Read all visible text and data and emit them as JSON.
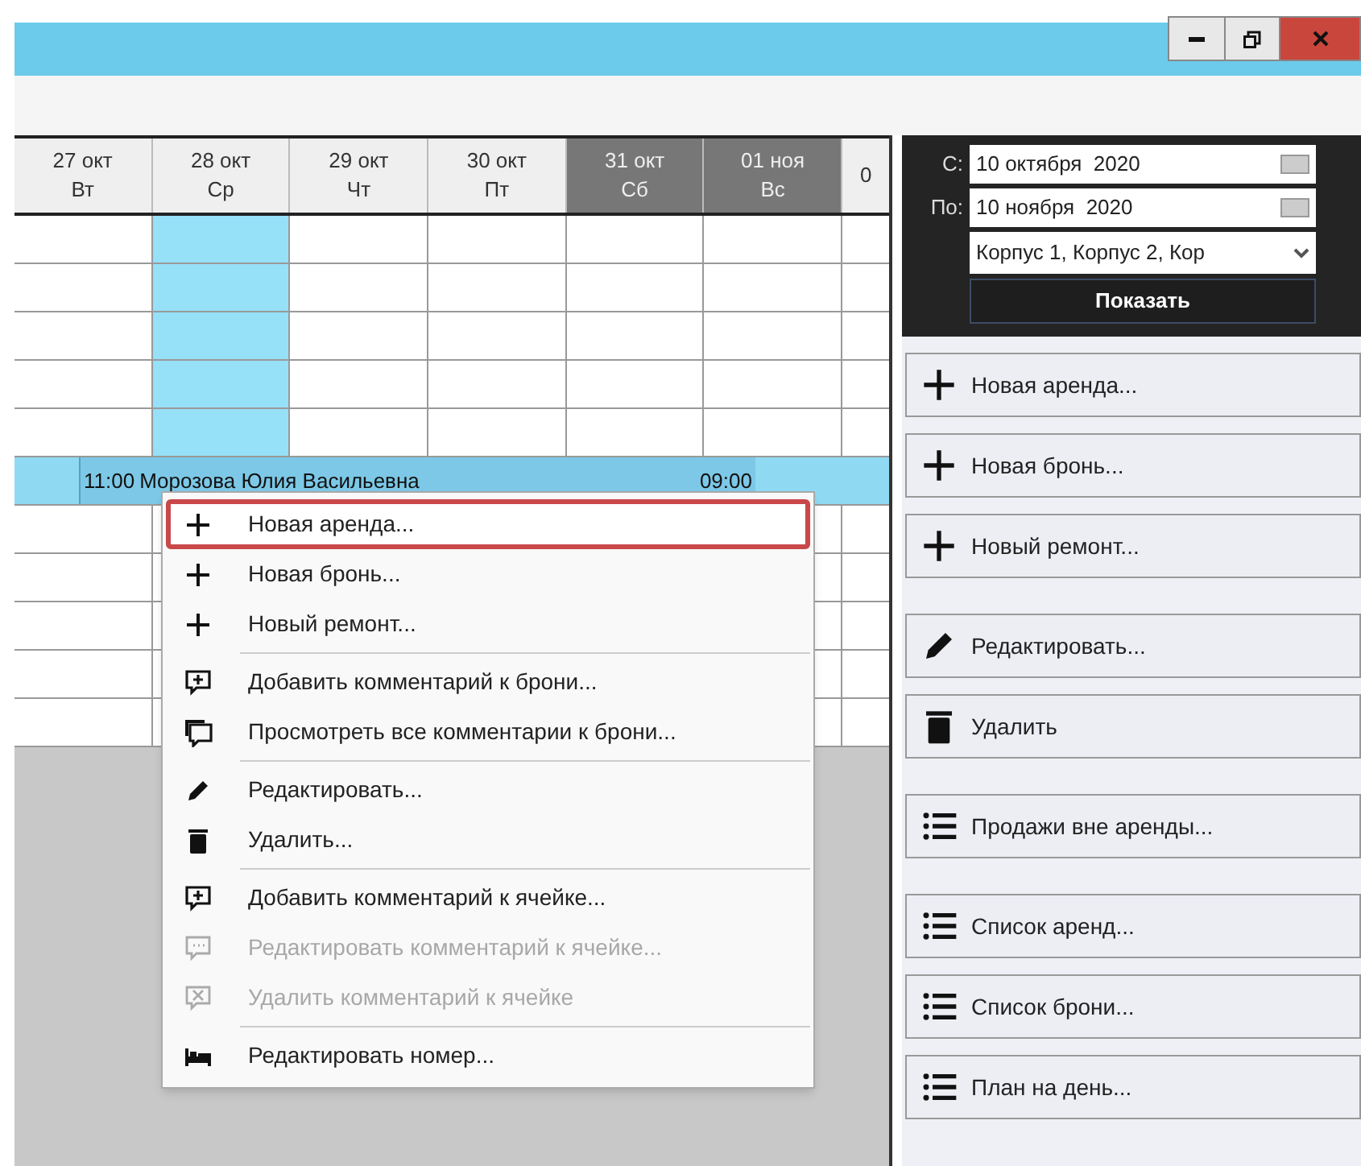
{
  "window_controls": [
    {
      "kind": "minimize"
    },
    {
      "kind": "restore"
    },
    {
      "kind": "close"
    }
  ],
  "calendar": {
    "columns": [
      {
        "date": "27 окт",
        "weekday": "Вт",
        "weekend": false,
        "selected": false
      },
      {
        "date": "28 окт",
        "weekday": "Ср",
        "weekend": false,
        "selected": true
      },
      {
        "date": "29 окт",
        "weekday": "Чт",
        "weekend": false,
        "selected": false
      },
      {
        "date": "30 окт",
        "weekday": "Пт",
        "weekend": false,
        "selected": false
      },
      {
        "date": "31 окт",
        "weekday": "Сб",
        "weekend": true,
        "selected": false
      },
      {
        "date": "01 ноя",
        "weekday": "Вс",
        "weekend": true,
        "selected": false
      },
      {
        "date": "0",
        "weekend": false,
        "selected": false
      }
    ],
    "booking": {
      "start": "11:00",
      "guest": "Морозова Юлия Васильевна",
      "end": "09:00"
    }
  },
  "context_menu": {
    "groups": [
      {
        "items": [
          {
            "kind": "plus",
            "label": "Новая аренда...",
            "selected": true,
            "disabled": false
          },
          {
            "kind": "plus",
            "label": "Новая бронь...",
            "selected": false,
            "disabled": false
          },
          {
            "kind": "plus",
            "label": "Новый ремонт...",
            "selected": false,
            "disabled": false
          }
        ]
      },
      {
        "items": [
          {
            "kind": "comment-add",
            "label": "Добавить комментарий к брони...",
            "selected": false,
            "disabled": false
          },
          {
            "kind": "comments",
            "label": "Просмотреть все комментарии к брони...",
            "selected": false,
            "disabled": false
          }
        ]
      },
      {
        "items": [
          {
            "kind": "pencil",
            "label": "Редактировать...",
            "selected": false,
            "disabled": false
          },
          {
            "kind": "trash",
            "label": "Удалить...",
            "selected": false,
            "disabled": false
          }
        ]
      },
      {
        "items": [
          {
            "kind": "comment-add",
            "label": "Добавить комментарий к ячейке...",
            "selected": false,
            "disabled": false
          },
          {
            "kind": "comment-dots",
            "label": "Редактировать комментарий к ячейке...",
            "selected": false,
            "disabled": true
          },
          {
            "kind": "comment-x",
            "label": "Удалить комментарий к ячейке",
            "selected": false,
            "disabled": true
          }
        ]
      },
      {
        "items": [
          {
            "kind": "bed",
            "label": "Редактировать номер...",
            "selected": false,
            "disabled": false
          }
        ]
      }
    ]
  },
  "filter": {
    "from_label": "С:",
    "from_value": "10 октября  2020",
    "to_label": "По:",
    "to_value": "10 ноября  2020",
    "buildings": "Корпус 1, Корпус 2, Кор",
    "show_button": "Показать"
  },
  "actions": {
    "groups": [
      {
        "items": [
          {
            "kind": "plus",
            "label": "Новая аренда..."
          },
          {
            "kind": "plus",
            "label": "Новая бронь..."
          },
          {
            "kind": "plus",
            "label": "Новый ремонт..."
          }
        ]
      },
      {
        "items": [
          {
            "kind": "pencil",
            "label": "Редактировать..."
          },
          {
            "kind": "trash",
            "label": "Удалить"
          }
        ]
      },
      {
        "items": [
          {
            "kind": "list",
            "label": "Продажи вне аренды..."
          }
        ]
      },
      {
        "items": [
          {
            "kind": "list",
            "label": "Список аренд..."
          },
          {
            "kind": "list",
            "label": "Список брони..."
          },
          {
            "kind": "list",
            "label": "План на день..."
          }
        ]
      }
    ]
  }
}
